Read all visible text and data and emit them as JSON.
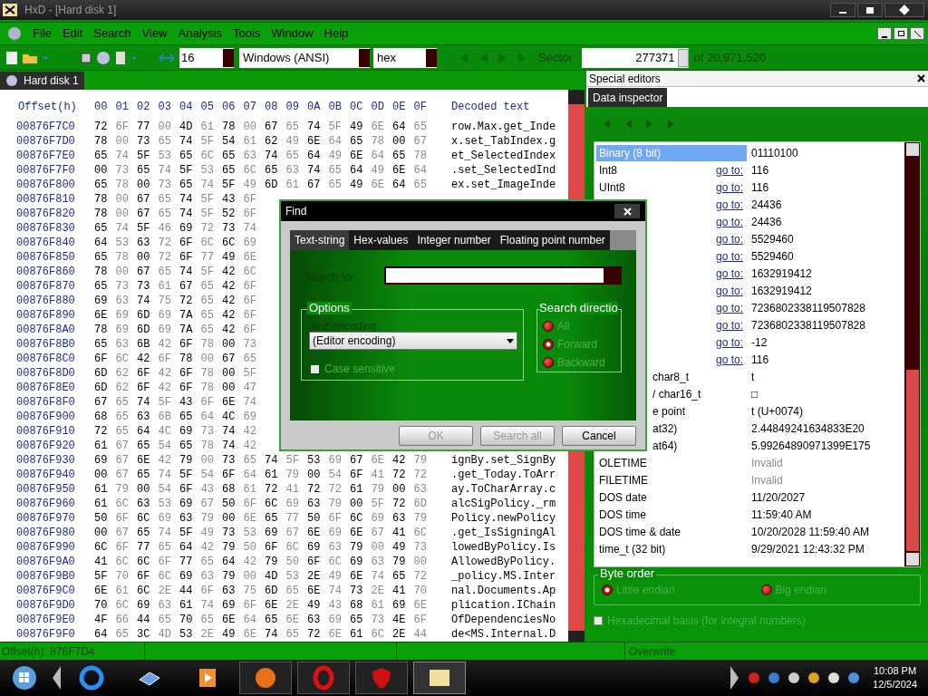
{
  "window": {
    "title": "HxD - [Hard disk 1]"
  },
  "menu": [
    "File",
    "Edit",
    "Search",
    "View",
    "Analysis",
    "Tools",
    "Window",
    "Help"
  ],
  "toolbar": {
    "bytes_per_row": "16",
    "charset": "Windows (ANSI)",
    "mode": "hex",
    "sector_label": "Sector",
    "sector": "277371",
    "sector_total": "of 20,971,520"
  },
  "doc_tab": {
    "label": "Hard disk 1",
    "selected": true
  },
  "hex": {
    "header": {
      "offset": "Offset(h)",
      "columns": [
        "00",
        "01",
        "02",
        "03",
        "04",
        "05",
        "06",
        "07",
        "08",
        "09",
        "0A",
        "0B",
        "0C",
        "0D",
        "0E",
        "0F"
      ],
      "decoded": "Decoded text"
    },
    "rows": [
      {
        "offset": "00876F7C0",
        "bytes": [
          "72",
          "6F",
          "77",
          "00",
          "4D",
          "61",
          "78",
          "00",
          "67",
          "65",
          "74",
          "5F",
          "49",
          "6E",
          "64",
          "65"
        ],
        "text": "row.Max.get_Inde"
      },
      {
        "offset": "00876F7D0",
        "bytes": [
          "78",
          "00",
          "73",
          "65",
          "74",
          "5F",
          "54",
          "61",
          "62",
          "49",
          "6E",
          "64",
          "65",
          "78",
          "00",
          "67"
        ],
        "text": "x.set_TabIndex.g"
      },
      {
        "offset": "00876F7E0",
        "bytes": [
          "65",
          "74",
          "5F",
          "53",
          "65",
          "6C",
          "65",
          "63",
          "74",
          "65",
          "64",
          "49",
          "6E",
          "64",
          "65",
          "78"
        ],
        "text": "et_SelectedIndex"
      },
      {
        "offset": "00876F7F0",
        "bytes": [
          "00",
          "73",
          "65",
          "74",
          "5F",
          "53",
          "65",
          "6C",
          "65",
          "63",
          "74",
          "65",
          "64",
          "49",
          "6E",
          "64"
        ],
        "text": ".set_SelectedInd"
      },
      {
        "offset": "00876F800",
        "bytes": [
          "65",
          "78",
          "00",
          "73",
          "65",
          "74",
          "5F",
          "49",
          "6D",
          "61",
          "67",
          "65",
          "49",
          "6E",
          "64",
          "65"
        ],
        "text": "ex.set_ImageInde"
      },
      {
        "offset": "00876F810",
        "bytes": [
          "78",
          "00",
          "67",
          "65",
          "74",
          "5F",
          "43",
          "6F"
        ]
      },
      {
        "offset": "00876F820",
        "bytes": [
          "78",
          "00",
          "67",
          "65",
          "74",
          "5F",
          "52",
          "6F"
        ]
      },
      {
        "offset": "00876F830",
        "bytes": [
          "65",
          "74",
          "5F",
          "46",
          "69",
          "72",
          "73",
          "74"
        ]
      },
      {
        "offset": "00876F840",
        "bytes": [
          "64",
          "53",
          "63",
          "72",
          "6F",
          "6C",
          "6C",
          "69"
        ]
      },
      {
        "offset": "00876F850",
        "bytes": [
          "65",
          "78",
          "00",
          "72",
          "6F",
          "77",
          "49",
          "6E"
        ]
      },
      {
        "offset": "00876F860",
        "bytes": [
          "78",
          "00",
          "67",
          "65",
          "74",
          "5F",
          "42",
          "6C"
        ]
      },
      {
        "offset": "00876F870",
        "bytes": [
          "65",
          "73",
          "73",
          "61",
          "67",
          "65",
          "42",
          "6F"
        ]
      },
      {
        "offset": "00876F880",
        "bytes": [
          "69",
          "63",
          "74",
          "75",
          "72",
          "65",
          "42",
          "6F"
        ]
      },
      {
        "offset": "00876F890",
        "bytes": [
          "6E",
          "69",
          "6D",
          "69",
          "7A",
          "65",
          "42",
          "6F"
        ]
      },
      {
        "offset": "00876F8A0",
        "bytes": [
          "78",
          "69",
          "6D",
          "69",
          "7A",
          "65",
          "42",
          "6F"
        ]
      },
      {
        "offset": "00876F8B0",
        "bytes": [
          "65",
          "63",
          "6B",
          "42",
          "6F",
          "78",
          "00",
          "73"
        ]
      },
      {
        "offset": "00876F8C0",
        "bytes": [
          "6F",
          "6C",
          "42",
          "6F",
          "78",
          "00",
          "67",
          "65"
        ]
      },
      {
        "offset": "00876F8D0",
        "bytes": [
          "6D",
          "62",
          "6F",
          "42",
          "6F",
          "78",
          "00",
          "5F"
        ]
      },
      {
        "offset": "00876F8E0",
        "bytes": [
          "6D",
          "62",
          "6F",
          "42",
          "6F",
          "78",
          "00",
          "47"
        ]
      },
      {
        "offset": "00876F8F0",
        "bytes": [
          "67",
          "65",
          "74",
          "5F",
          "43",
          "6F",
          "6E",
          "74"
        ]
      },
      {
        "offset": "00876F900",
        "bytes": [
          "68",
          "65",
          "63",
          "6B",
          "65",
          "64",
          "4C",
          "69"
        ]
      },
      {
        "offset": "00876F910",
        "bytes": [
          "72",
          "65",
          "64",
          "4C",
          "69",
          "73",
          "74",
          "42"
        ]
      },
      {
        "offset": "00876F920",
        "bytes": [
          "61",
          "67",
          "65",
          "54",
          "65",
          "78",
          "74",
          "42"
        ]
      },
      {
        "offset": "00876F930",
        "bytes": [
          "69",
          "67",
          "6E",
          "42",
          "79",
          "00",
          "73",
          "65",
          "74",
          "5F",
          "53",
          "69",
          "67",
          "6E",
          "42",
          "79"
        ],
        "text": "ignBy.set_SignBy"
      },
      {
        "offset": "00876F940",
        "bytes": [
          "00",
          "67",
          "65",
          "74",
          "5F",
          "54",
          "6F",
          "64",
          "61",
          "79",
          "00",
          "54",
          "6F",
          "41",
          "72",
          "72"
        ],
        "text": ".get_Today.ToArr"
      },
      {
        "offset": "00876F950",
        "bytes": [
          "61",
          "79",
          "00",
          "54",
          "6F",
          "43",
          "68",
          "61",
          "72",
          "41",
          "72",
          "72",
          "61",
          "79",
          "00",
          "63"
        ],
        "text": "ay.ToCharArray.c"
      },
      {
        "offset": "00876F960",
        "bytes": [
          "61",
          "6C",
          "63",
          "53",
          "69",
          "67",
          "50",
          "6F",
          "6C",
          "69",
          "63",
          "79",
          "00",
          "5F",
          "72",
          "6D"
        ],
        "text": "alcSigPolicy._rm"
      },
      {
        "offset": "00876F970",
        "bytes": [
          "50",
          "6F",
          "6C",
          "69",
          "63",
          "79",
          "00",
          "6E",
          "65",
          "77",
          "50",
          "6F",
          "6C",
          "69",
          "63",
          "79"
        ],
        "text": "Policy.newPolicy"
      },
      {
        "offset": "00876F980",
        "bytes": [
          "00",
          "67",
          "65",
          "74",
          "5F",
          "49",
          "73",
          "53",
          "69",
          "67",
          "6E",
          "69",
          "6E",
          "67",
          "41",
          "6C"
        ],
        "text": ".get_IsSigningAl"
      },
      {
        "offset": "00876F990",
        "bytes": [
          "6C",
          "6F",
          "77",
          "65",
          "64",
          "42",
          "79",
          "50",
          "6F",
          "6C",
          "69",
          "63",
          "79",
          "00",
          "49",
          "73"
        ],
        "text": "lowedByPolicy.Is"
      },
      {
        "offset": "00876F9A0",
        "bytes": [
          "41",
          "6C",
          "6C",
          "6F",
          "77",
          "65",
          "64",
          "42",
          "79",
          "50",
          "6F",
          "6C",
          "69",
          "63",
          "79",
          "00"
        ],
        "text": "AllowedByPolicy."
      },
      {
        "offset": "00876F9B0",
        "bytes": [
          "5F",
          "70",
          "6F",
          "6C",
          "69",
          "63",
          "79",
          "00",
          "4D",
          "53",
          "2E",
          "49",
          "6E",
          "74",
          "65",
          "72"
        ],
        "text": "_policy.MS.Inter"
      },
      {
        "offset": "00876F9C0",
        "bytes": [
          "6E",
          "61",
          "6C",
          "2E",
          "44",
          "6F",
          "63",
          "75",
          "6D",
          "65",
          "6E",
          "74",
          "73",
          "2E",
          "41",
          "70"
        ],
        "text": "nal.Documents.Ap"
      },
      {
        "offset": "00876F9D0",
        "bytes": [
          "70",
          "6C",
          "69",
          "63",
          "61",
          "74",
          "69",
          "6F",
          "6E",
          "2E",
          "49",
          "43",
          "68",
          "61",
          "69",
          "6E"
        ],
        "text": "plication.IChain"
      },
      {
        "offset": "00876F9E0",
        "bytes": [
          "4F",
          "66",
          "44",
          "65",
          "70",
          "65",
          "6E",
          "64",
          "65",
          "6E",
          "63",
          "69",
          "65",
          "73",
          "4E",
          "6F"
        ],
        "text": "OfDependenciesNo"
      },
      {
        "offset": "00876F9F0",
        "bytes": [
          "64",
          "65",
          "3C",
          "4D",
          "53",
          "2E",
          "49",
          "6E",
          "74",
          "65",
          "72",
          "6E",
          "61",
          "6C",
          "2E",
          "44"
        ],
        "text": "de<MS.Internal.D"
      }
    ]
  },
  "special_editors": {
    "title": "Special editors",
    "tab": {
      "label": "Data inspector",
      "selected": true
    },
    "rows": [
      {
        "name": "Binary (8 bit)",
        "value": "01110100",
        "selected": true
      },
      {
        "name": "Int8",
        "goto": "go to:",
        "value": "116",
        "selected": false
      },
      {
        "name": "UInt8",
        "goto": "go to:",
        "value": "116",
        "selected": false
      },
      {
        "goto": "go to:",
        "value": "24436",
        "selected": false
      },
      {
        "goto": "go to:",
        "value": "24436",
        "selected": false
      },
      {
        "goto": "go to:",
        "value": "5529460",
        "selected": false
      },
      {
        "goto": "go to:",
        "value": "5529460",
        "selected": false
      },
      {
        "goto": "go to:",
        "value": "1632919412",
        "selected": false
      },
      {
        "goto": "go to:",
        "value": "1632919412",
        "selected": false
      },
      {
        "goto": "go to:",
        "value": "7236802338119507828",
        "selected": false
      },
      {
        "goto": "go to:",
        "value": "7236802338119507828",
        "selected": false
      },
      {
        "goto": "go to:",
        "value": "-12",
        "selected": false
      },
      {
        "goto": "go to:",
        "value": "116",
        "selected": false
      },
      {
        "name": "char8_t",
        "kind": "cut",
        "value": "t",
        "selected": false
      },
      {
        "name": "/ char16_t",
        "kind": "cut",
        "value": "□",
        "selected": false
      },
      {
        "name": "e point",
        "kind": "cut",
        "value": "t (U+0074)",
        "selected": false
      },
      {
        "name": "at32)",
        "kind": "cut",
        "value": "2.44849241634833E20",
        "selected": false
      },
      {
        "name": "at64)",
        "kind": "cut",
        "value": "5.99264890971399E175",
        "selected": false
      },
      {
        "name": "OLETIME",
        "value": "Invalid",
        "invalid": true,
        "selected": false
      },
      {
        "name": "FILETIME",
        "value": "Invalid",
        "invalid": true,
        "selected": false
      },
      {
        "name": "DOS date",
        "value": "11/20/2027",
        "selected": false
      },
      {
        "name": "DOS time",
        "value": "11:59:40 AM",
        "selected": false
      },
      {
        "name": "DOS time & date",
        "value": "10/20/2028 11:59:40 AM",
        "selected": false
      },
      {
        "name": "time_t (32 bit)",
        "value": "9/29/2021 12:43:32 PM",
        "selected": false
      }
    ],
    "byte_order": {
      "title": "Byte order",
      "options": [
        {
          "label": "Little endian",
          "selected": true
        },
        {
          "label": "Big endian",
          "selected": false
        }
      ]
    },
    "hex_basis": {
      "label": "Hexadecimal basis (for integral numbers)",
      "checked": false
    }
  },
  "status_bar": {
    "offset": "Offset(h): 876F7D4",
    "mode": "Overwrite"
  },
  "find_dialog": {
    "title": "Find",
    "tabs": [
      {
        "label": "Text-string",
        "selected": true
      },
      {
        "label": "Hex-values",
        "selected": false
      },
      {
        "label": "Integer number",
        "selected": false
      },
      {
        "label": "Floating point number",
        "selected": false
      }
    ],
    "search_label": "Search for:",
    "options_title": "Options",
    "encoding_label": "Text encoding:",
    "encoding": "(Editor encoding)",
    "case_sensitive": {
      "label": "Case sensitive",
      "checked": false
    },
    "direction_title": "Search directio",
    "directions": [
      {
        "label": "All",
        "selected": false
      },
      {
        "label": "Forward",
        "selected": true
      },
      {
        "label": "Backward",
        "selected": false
      }
    ],
    "buttons": [
      {
        "label": "OK",
        "disabled": true
      },
      {
        "label": "Search all",
        "disabled": true
      },
      {
        "label": "Cancel",
        "disabled": false
      }
    ]
  },
  "taskbar": {
    "time": "10:08 PM",
    "date": "12/5/2024"
  }
}
